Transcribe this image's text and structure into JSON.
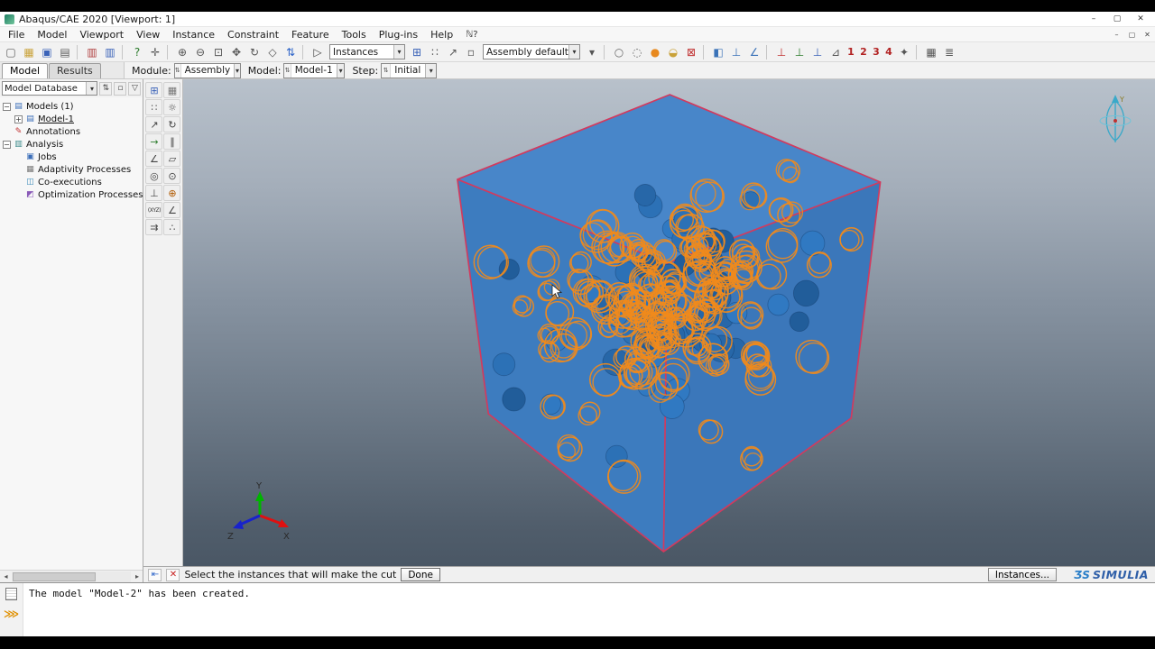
{
  "window": {
    "title": "Abaqus/CAE 2020 [Viewport: 1]",
    "controls": [
      "–",
      "▢",
      "✕"
    ]
  },
  "icons": {
    "chevron_down": "▾",
    "combo_spin": "⇅",
    "filter": "▽",
    "tree_spin": "⇅",
    "tree_link": "▫",
    "scroll_left": "◂",
    "scroll_right": "▸",
    "prompt_back": "⇤",
    "prompt_cancel": "✕",
    "command_line": "⋙"
  },
  "menubar": {
    "items": [
      "File",
      "Model",
      "Viewport",
      "View",
      "Instance",
      "Constraint",
      "Feature",
      "Tools",
      "Plug-ins",
      "Help"
    ],
    "context_help": "ℕ?",
    "mdi_controls": [
      "–",
      "▢",
      "✕"
    ]
  },
  "toolbar": {
    "items": [
      {
        "t": "icon",
        "n": "new-model-icon",
        "g": "▢",
        "c": "#5a5a5a"
      },
      {
        "t": "icon",
        "n": "open-icon",
        "g": "▦",
        "c": "#c9a23a"
      },
      {
        "t": "icon",
        "n": "save-icon",
        "g": "▣",
        "c": "#3a62b8"
      },
      {
        "t": "icon",
        "n": "print-icon",
        "g": "▤",
        "c": "#5a5a5a"
      },
      {
        "t": "sep"
      },
      {
        "t": "icon",
        "n": "model-database-icon",
        "g": "▥",
        "c": "#b04040"
      },
      {
        "t": "icon",
        "n": "output-database-icon",
        "g": "▥",
        "c": "#3a62b8"
      },
      {
        "t": "sep"
      },
      {
        "t": "icon",
        "n": "query-icon",
        "g": "?",
        "c": "#2a7a2a"
      },
      {
        "t": "icon",
        "n": "tools-icon",
        "g": "✛",
        "c": "#555555"
      },
      {
        "t": "sep"
      },
      {
        "t": "icon",
        "n": "zoom-in-icon",
        "g": "⊕",
        "c": "#555555"
      },
      {
        "t": "icon",
        "n": "zoom-out-icon",
        "g": "⊖",
        "c": "#555555"
      },
      {
        "t": "icon",
        "n": "zoom-box-icon",
        "g": "⊡",
        "c": "#555555"
      },
      {
        "t": "icon",
        "n": "pan-view-icon",
        "g": "✥",
        "c": "#555555"
      },
      {
        "t": "icon",
        "n": "rotate-view-icon",
        "g": "↻",
        "c": "#555555"
      },
      {
        "t": "icon",
        "n": "fit-view-icon",
        "g": "◇",
        "c": "#555555"
      },
      {
        "t": "icon",
        "n": "cycle-views-icon",
        "g": "⇅",
        "c": "#2a62c8"
      },
      {
        "t": "sep"
      },
      {
        "t": "icon",
        "n": "select-cursor-icon",
        "g": "▷",
        "c": "#444444"
      },
      {
        "t": "combo",
        "n": "instances-combo",
        "v": "Instances",
        "w": 84
      },
      {
        "t": "icon",
        "n": "create-instance-icon",
        "g": "⊞",
        "c": "#3a62b8"
      },
      {
        "t": "icon",
        "n": "pattern-icon",
        "g": "∷",
        "c": "#555555"
      },
      {
        "t": "icon",
        "n": "translate-icon",
        "g": "↗",
        "c": "#555555"
      },
      {
        "t": "icon",
        "n": "selection-box-icon",
        "g": "▫",
        "c": "#555555"
      },
      {
        "t": "combo",
        "n": "color-code-combo",
        "v": "Assembly defaults",
        "w": 108
      },
      {
        "t": "icon",
        "n": "color-options-icon",
        "g": "▾",
        "c": "#555555"
      },
      {
        "t": "sep"
      },
      {
        "t": "icon",
        "n": "wireframe-render-icon",
        "g": "○",
        "c": "#666666"
      },
      {
        "t": "icon",
        "n": "hidden-line-render-icon",
        "g": "◌",
        "c": "#666666"
      },
      {
        "t": "icon",
        "n": "shaded-render-icon",
        "g": "●",
        "c": "#e8891e"
      },
      {
        "t": "icon",
        "n": "view-cut-icon",
        "g": "◒",
        "c": "#c9a23a"
      },
      {
        "t": "icon",
        "n": "remove-view-cut-icon",
        "g": "⊠",
        "c": "#c03030"
      },
      {
        "t": "sep"
      },
      {
        "t": "icon",
        "n": "datum-plane-icon",
        "g": "◧",
        "c": "#3a72b8"
      },
      {
        "t": "icon",
        "n": "datum-axis-icon",
        "g": "⊥",
        "c": "#3a72b8"
      },
      {
        "t": "icon",
        "n": "measure-angle-icon",
        "g": "∠",
        "c": "#3a72b8"
      },
      {
        "t": "sep"
      },
      {
        "t": "icon",
        "n": "view-along-x-icon",
        "g": "⊥",
        "c": "#c03030"
      },
      {
        "t": "icon",
        "n": "view-along-y-icon",
        "g": "⊥",
        "c": "#2a7a2a"
      },
      {
        "t": "icon",
        "n": "view-along-z-icon",
        "g": "⊥",
        "c": "#3a62b8"
      },
      {
        "t": "icon",
        "n": "custom-view-icon",
        "g": "⊿",
        "c": "#555555"
      },
      {
        "t": "num",
        "n": "view-preset-1-button",
        "v": "1"
      },
      {
        "t": "num",
        "n": "view-preset-2-button",
        "v": "2"
      },
      {
        "t": "num",
        "n": "view-preset-3-button",
        "v": "3"
      },
      {
        "t": "num",
        "n": "view-preset-4-button",
        "v": "4"
      },
      {
        "t": "icon",
        "n": "save-view-icon",
        "g": "✦",
        "c": "#555555"
      },
      {
        "t": "sep"
      },
      {
        "t": "icon",
        "n": "display-group-icon",
        "g": "▦",
        "c": "#555555"
      },
      {
        "t": "icon",
        "n": "layers-icon",
        "g": "≣",
        "c": "#555555"
      }
    ]
  },
  "contextbar": {
    "module_label": "Module:",
    "module_value": "Assembly",
    "model_label": "Model:",
    "model_value": "Model-1",
    "step_label": "Step:",
    "step_value": "Initial"
  },
  "left_panel": {
    "tabs": [
      "Model",
      "Results"
    ],
    "database_combo": "Model Database",
    "tree": [
      {
        "label": "Models (1)",
        "level": 0,
        "e": "-",
        "g": "▤",
        "c": "#3a6db8"
      },
      {
        "label": "Model-1",
        "level": 1,
        "e": "+",
        "g": "▤",
        "c": "#3a6db8",
        "u": true
      },
      {
        "label": "Annotations",
        "level": 0,
        "e": "",
        "g": "✎",
        "c": "#c03030"
      },
      {
        "label": "Analysis",
        "level": 0,
        "e": "-",
        "g": "▥",
        "c": "#3a8a8a"
      },
      {
        "label": "Jobs",
        "level": 1,
        "e": "",
        "g": "▣",
        "c": "#3a6db8"
      },
      {
        "label": "Adaptivity Processes",
        "level": 1,
        "e": "",
        "g": "▦",
        "c": "#777777"
      },
      {
        "label": "Co-executions",
        "level": 1,
        "e": "",
        "g": "◫",
        "c": "#3a8ab8"
      },
      {
        "label": "Optimization Processes",
        "level": 1,
        "e": "",
        "g": "◩",
        "c": "#8a5ab8"
      }
    ]
  },
  "toolbox": {
    "items": [
      {
        "n": "create-instance-icon",
        "g": "⊞",
        "c": "#3a62b8"
      },
      {
        "n": "instance-manager-icon",
        "g": "▦",
        "c": "#777777"
      },
      {
        "n": "linear-pattern-icon",
        "g": "∷",
        "c": "#555555"
      },
      {
        "n": "radial-pattern-icon",
        "g": "☼",
        "c": "#555555"
      },
      {
        "n": "translate-instance-icon",
        "g": "↗",
        "c": "#444444"
      },
      {
        "n": "rotate-instance-icon",
        "g": "↻",
        "c": "#444444"
      },
      {
        "n": "translate-to-icon",
        "g": "→",
        "c": "#2f7d2f"
      },
      {
        "n": "create-constraint-icon",
        "g": "∥",
        "c": "#444444"
      },
      {
        "n": "edge-to-edge-icon",
        "g": "∠",
        "c": "#444444"
      },
      {
        "n": "face-to-face-icon",
        "g": "▱",
        "c": "#444444"
      },
      {
        "n": "coaxial-icon",
        "g": "◎",
        "c": "#444444"
      },
      {
        "n": "coincident-point-icon",
        "g": "⊙",
        "c": "#444444"
      },
      {
        "n": "parallel-csys-icon",
        "g": "⊥",
        "c": "#444444"
      },
      {
        "n": "merge-cut-instances-icon",
        "g": "⊕",
        "c": "#b05a00"
      },
      {
        "n": "translate-coordinates-icon",
        "g": "(XYZ)",
        "c": "#333333",
        "small": true
      },
      {
        "n": "rotate-about-axis-icon",
        "g": "∠",
        "c": "#444444"
      },
      {
        "n": "offset-instances-icon",
        "g": "⇉",
        "c": "#444444"
      },
      {
        "n": "instance-array-icon",
        "g": "∴",
        "c": "#444444"
      }
    ]
  },
  "prompt": {
    "text": "Select the instances that will make the cut",
    "done_label": "Done",
    "instances_label": "Instances...",
    "brand_mark": "ƷS",
    "brand": "SIMULIA"
  },
  "message": {
    "text": "The model \"Model-2\" has been created."
  },
  "viewport": {
    "triad": {
      "x": "X",
      "y": "Y",
      "z": "Z"
    },
    "compass_label": "Y",
    "scene": {
      "edge_color": "#d23a5e",
      "face_top": "#4886c9",
      "face_left": "#3d7cbf",
      "face_right": "#3b77ba",
      "orange": "#ef8a1c",
      "blue_fills": [
        "#3079c2",
        "#2c71b6",
        "#2767a8",
        "#215d9a"
      ],
      "orange_count": 132,
      "blue_count": 50,
      "seed": 9
    }
  }
}
